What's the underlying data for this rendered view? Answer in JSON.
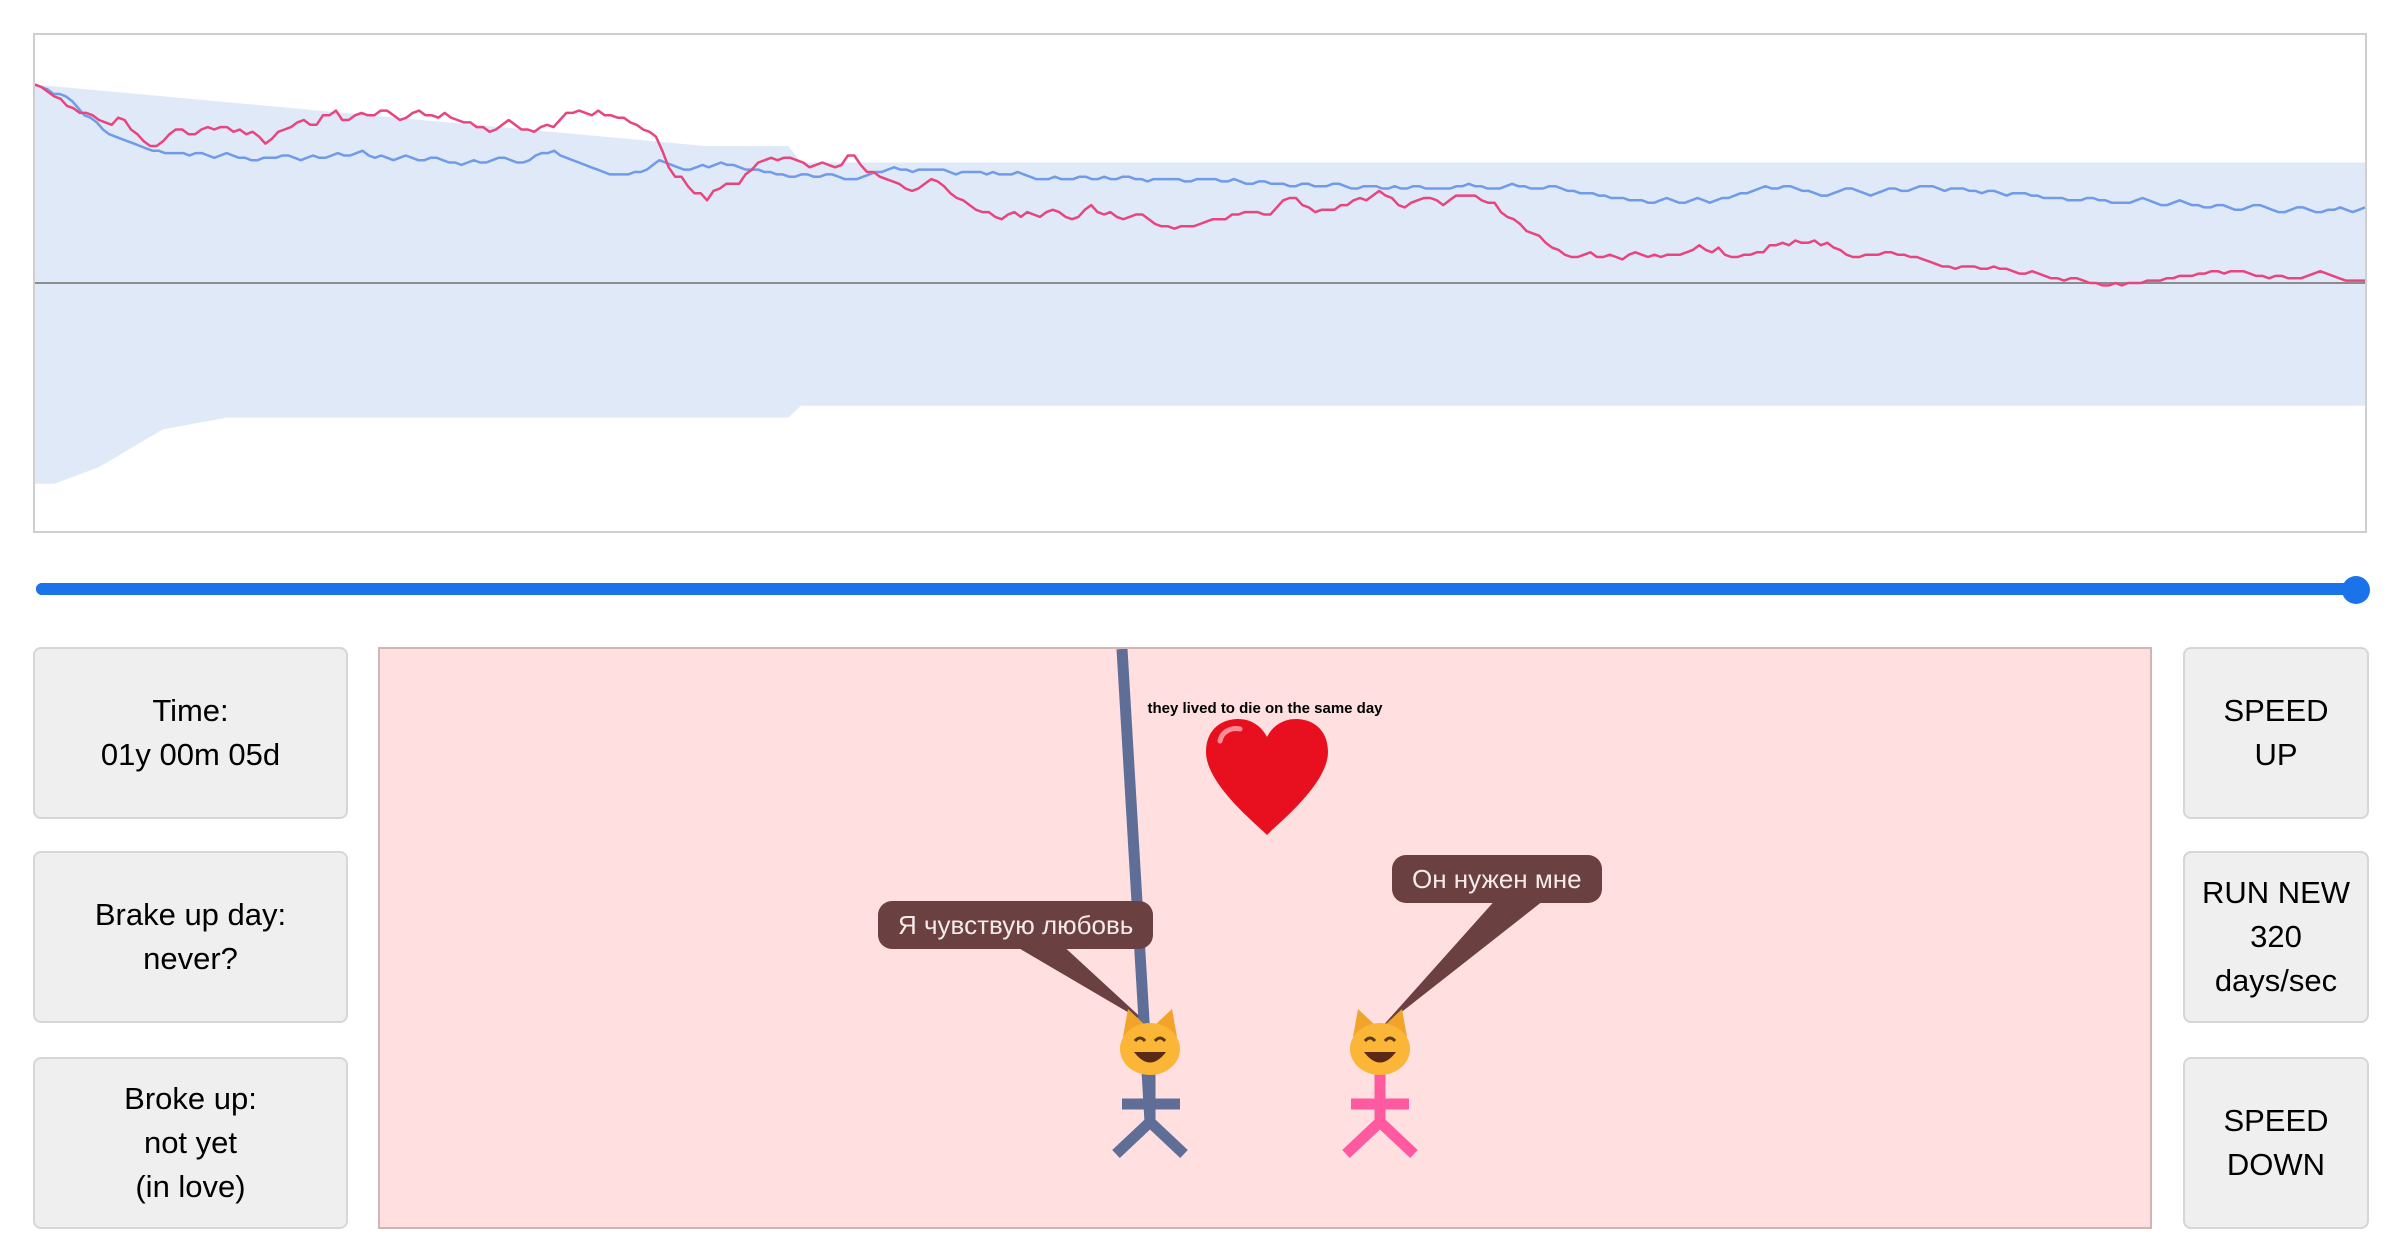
{
  "chart_data": {
    "type": "line",
    "title": "",
    "xlabel": "",
    "ylabel": "",
    "baseline_y": 0,
    "ylim": [
      -1.05,
      1.05
    ],
    "x": [
      0,
      365
    ],
    "series": [
      {
        "color": "#6f9be8",
        "values": [
          0.84,
          0.83,
          0.82,
          0.8,
          0.8,
          0.79,
          0.77,
          0.74,
          0.71,
          0.7,
          0.68,
          0.65,
          0.63,
          0.62,
          0.61,
          0.6,
          0.59,
          0.58,
          0.57,
          0.56,
          0.56,
          0.55,
          0.55,
          0.55,
          0.55,
          0.54,
          0.55,
          0.55,
          0.54,
          0.53,
          0.54,
          0.55,
          0.54,
          0.53,
          0.53,
          0.52,
          0.52,
          0.53,
          0.53,
          0.53,
          0.54,
          0.54,
          0.53,
          0.52,
          0.53,
          0.54,
          0.53,
          0.53,
          0.54,
          0.55,
          0.54,
          0.54,
          0.55,
          0.56,
          0.54,
          0.53,
          0.54,
          0.53,
          0.52,
          0.53,
          0.54,
          0.53,
          0.52,
          0.52,
          0.53,
          0.53,
          0.52,
          0.51,
          0.51,
          0.5,
          0.51,
          0.52,
          0.51,
          0.51,
          0.52,
          0.53,
          0.53,
          0.52,
          0.51,
          0.51,
          0.52,
          0.54,
          0.55,
          0.55,
          0.56,
          0.54,
          0.53,
          0.52,
          0.51,
          0.5,
          0.49,
          0.48,
          0.47,
          0.46,
          0.46,
          0.46,
          0.46,
          0.47,
          0.47,
          0.48,
          0.5,
          0.52,
          0.51,
          0.5,
          0.49,
          0.48,
          0.48,
          0.49,
          0.5,
          0.49,
          0.5,
          0.51,
          0.5,
          0.5,
          0.49,
          0.48,
          0.48,
          0.48,
          0.47,
          0.47,
          0.46,
          0.46,
          0.45,
          0.45,
          0.46,
          0.46,
          0.45,
          0.45,
          0.46,
          0.46,
          0.45,
          0.44,
          0.44,
          0.44,
          0.45,
          0.46,
          0.47,
          0.47,
          0.48,
          0.49,
          0.48,
          0.48,
          0.47,
          0.48,
          0.48,
          0.48,
          0.48,
          0.48,
          0.47,
          0.46,
          0.47,
          0.47,
          0.47,
          0.47,
          0.46,
          0.47,
          0.46,
          0.46,
          0.46,
          0.47,
          0.46,
          0.45,
          0.44,
          0.44,
          0.44,
          0.45,
          0.44,
          0.44,
          0.44,
          0.45,
          0.45,
          0.44,
          0.44,
          0.45,
          0.44,
          0.44,
          0.45,
          0.45,
          0.44,
          0.44,
          0.43,
          0.44,
          0.44,
          0.44,
          0.44,
          0.44,
          0.43,
          0.43,
          0.44,
          0.44,
          0.44,
          0.44,
          0.43,
          0.43,
          0.44,
          0.43,
          0.42,
          0.42,
          0.43,
          0.43,
          0.42,
          0.42,
          0.42,
          0.41,
          0.41,
          0.42,
          0.42,
          0.41,
          0.41,
          0.41,
          0.42,
          0.42,
          0.41,
          0.4,
          0.4,
          0.41,
          0.41,
          0.41,
          0.4,
          0.4,
          0.41,
          0.4,
          0.4,
          0.41,
          0.41,
          0.4,
          0.4,
          0.4,
          0.4,
          0.4,
          0.41,
          0.41,
          0.42,
          0.41,
          0.41,
          0.4,
          0.4,
          0.4,
          0.41,
          0.42,
          0.41,
          0.41,
          0.4,
          0.4,
          0.4,
          0.41,
          0.41,
          0.4,
          0.39,
          0.39,
          0.38,
          0.38,
          0.38,
          0.37,
          0.37,
          0.36,
          0.36,
          0.36,
          0.35,
          0.35,
          0.35,
          0.34,
          0.34,
          0.35,
          0.36,
          0.35,
          0.34,
          0.34,
          0.35,
          0.36,
          0.35,
          0.34,
          0.35,
          0.36,
          0.36,
          0.37,
          0.38,
          0.38,
          0.39,
          0.4,
          0.41,
          0.4,
          0.4,
          0.41,
          0.41,
          0.4,
          0.39,
          0.39,
          0.38,
          0.37,
          0.37,
          0.38,
          0.39,
          0.4,
          0.4,
          0.39,
          0.38,
          0.37,
          0.38,
          0.39,
          0.4,
          0.4,
          0.39,
          0.39,
          0.4,
          0.41,
          0.41,
          0.41,
          0.4,
          0.39,
          0.4,
          0.4,
          0.4,
          0.39,
          0.39,
          0.38,
          0.39,
          0.39,
          0.38,
          0.37,
          0.38,
          0.38,
          0.38,
          0.37,
          0.37,
          0.36,
          0.36,
          0.36,
          0.36,
          0.35,
          0.35,
          0.35,
          0.36,
          0.36,
          0.35,
          0.35,
          0.34,
          0.34,
          0.34,
          0.34,
          0.35,
          0.36,
          0.35,
          0.34,
          0.33,
          0.33,
          0.34,
          0.35,
          0.34,
          0.33,
          0.33,
          0.32,
          0.32,
          0.33,
          0.33,
          0.32,
          0.31,
          0.31,
          0.32,
          0.33,
          0.33,
          0.32,
          0.31,
          0.3,
          0.3,
          0.31,
          0.32,
          0.32,
          0.31,
          0.3,
          0.3,
          0.31,
          0.31,
          0.32,
          0.31,
          0.3,
          0.31,
          0.32
        ]
      },
      {
        "color": "#e8457f",
        "values": [
          0.84,
          0.83,
          0.81,
          0.79,
          0.78,
          0.75,
          0.74,
          0.72,
          0.72,
          0.71,
          0.69,
          0.68,
          0.67,
          0.7,
          0.69,
          0.65,
          0.63,
          0.6,
          0.58,
          0.58,
          0.6,
          0.63,
          0.65,
          0.65,
          0.63,
          0.63,
          0.65,
          0.66,
          0.65,
          0.66,
          0.66,
          0.64,
          0.65,
          0.63,
          0.64,
          0.62,
          0.59,
          0.61,
          0.64,
          0.65,
          0.66,
          0.68,
          0.69,
          0.67,
          0.67,
          0.71,
          0.71,
          0.73,
          0.69,
          0.69,
          0.71,
          0.72,
          0.71,
          0.71,
          0.73,
          0.73,
          0.71,
          0.69,
          0.7,
          0.72,
          0.73,
          0.71,
          0.71,
          0.7,
          0.72,
          0.7,
          0.69,
          0.68,
          0.68,
          0.66,
          0.66,
          0.64,
          0.65,
          0.67,
          0.69,
          0.67,
          0.65,
          0.65,
          0.64,
          0.66,
          0.67,
          0.66,
          0.69,
          0.72,
          0.72,
          0.73,
          0.72,
          0.71,
          0.73,
          0.71,
          0.71,
          0.7,
          0.7,
          0.68,
          0.67,
          0.65,
          0.64,
          0.62,
          0.56,
          0.49,
          0.45,
          0.45,
          0.41,
          0.38,
          0.38,
          0.35,
          0.39,
          0.4,
          0.42,
          0.42,
          0.42,
          0.46,
          0.48,
          0.51,
          0.52,
          0.53,
          0.52,
          0.53,
          0.53,
          0.52,
          0.51,
          0.49,
          0.5,
          0.51,
          0.5,
          0.49,
          0.5,
          0.54,
          0.54,
          0.5,
          0.47,
          0.47,
          0.45,
          0.44,
          0.43,
          0.42,
          0.4,
          0.39,
          0.4,
          0.42,
          0.44,
          0.43,
          0.41,
          0.38,
          0.36,
          0.35,
          0.33,
          0.31,
          0.3,
          0.3,
          0.28,
          0.27,
          0.29,
          0.3,
          0.28,
          0.3,
          0.29,
          0.28,
          0.3,
          0.31,
          0.3,
          0.28,
          0.27,
          0.28,
          0.31,
          0.33,
          0.3,
          0.29,
          0.3,
          0.28,
          0.27,
          0.28,
          0.29,
          0.29,
          0.27,
          0.25,
          0.24,
          0.24,
          0.23,
          0.24,
          0.24,
          0.24,
          0.25,
          0.26,
          0.27,
          0.27,
          0.27,
          0.29,
          0.29,
          0.3,
          0.3,
          0.3,
          0.29,
          0.29,
          0.32,
          0.35,
          0.36,
          0.36,
          0.33,
          0.32,
          0.3,
          0.31,
          0.31,
          0.31,
          0.33,
          0.33,
          0.35,
          0.36,
          0.35,
          0.37,
          0.39,
          0.37,
          0.36,
          0.33,
          0.32,
          0.34,
          0.35,
          0.36,
          0.36,
          0.35,
          0.33,
          0.35,
          0.37,
          0.37,
          0.37,
          0.37,
          0.35,
          0.34,
          0.34,
          0.3,
          0.28,
          0.27,
          0.25,
          0.22,
          0.21,
          0.2,
          0.17,
          0.15,
          0.14,
          0.12,
          0.11,
          0.11,
          0.12,
          0.13,
          0.11,
          0.11,
          0.12,
          0.11,
          0.1,
          0.12,
          0.13,
          0.12,
          0.11,
          0.12,
          0.11,
          0.12,
          0.12,
          0.12,
          0.13,
          0.14,
          0.16,
          0.14,
          0.13,
          0.15,
          0.12,
          0.11,
          0.11,
          0.12,
          0.12,
          0.13,
          0.13,
          0.16,
          0.16,
          0.17,
          0.16,
          0.18,
          0.17,
          0.17,
          0.18,
          0.16,
          0.17,
          0.15,
          0.14,
          0.12,
          0.11,
          0.11,
          0.12,
          0.12,
          0.12,
          0.13,
          0.13,
          0.12,
          0.12,
          0.11,
          0.11,
          0.1,
          0.09,
          0.08,
          0.07,
          0.07,
          0.06,
          0.07,
          0.07,
          0.07,
          0.06,
          0.06,
          0.07,
          0.06,
          0.06,
          0.05,
          0.04,
          0.04,
          0.05,
          0.04,
          0.03,
          0.02,
          0.02,
          0.01,
          0.02,
          0.02,
          0.01,
          0.0,
          0.0,
          -0.01,
          -0.01,
          0.0,
          -0.01,
          0.0,
          0.0,
          0.0,
          0.01,
          0.01,
          0.01,
          0.02,
          0.02,
          0.03,
          0.03,
          0.03,
          0.04,
          0.04,
          0.05,
          0.05,
          0.04,
          0.05,
          0.05,
          0.05,
          0.04,
          0.03,
          0.03,
          0.02,
          0.03,
          0.03,
          0.02,
          0.02,
          0.02,
          0.03,
          0.04,
          0.05,
          0.04,
          0.03,
          0.02,
          0.01,
          0.01,
          0.01,
          0.01
        ]
      }
    ],
    "band": {
      "color": "#e0e9f8",
      "upper": [
        [
          0,
          0.84
        ],
        [
          105,
          0.58
        ],
        [
          118,
          0.58
        ],
        [
          120,
          0.51
        ],
        [
          365,
          0.51
        ]
      ],
      "lower": [
        [
          0,
          -0.85
        ],
        [
          3,
          -0.85
        ],
        [
          10,
          -0.78
        ],
        [
          20,
          -0.62
        ],
        [
          30,
          -0.57
        ],
        [
          118,
          -0.57
        ],
        [
          120,
          -0.52
        ],
        [
          365,
          -0.52
        ]
      ]
    },
    "baseline_color": "#8c8c8c"
  },
  "slider": {
    "value_fraction": 1.0,
    "fill_color": "#1a73e8",
    "track_color": "#1a73e8",
    "thumb_color": "#1a73e8"
  },
  "left_panel": {
    "time": "Time:\n01y 00m 05d",
    "brake_up_day": "Brake up day:\nnever?",
    "broke_up": "Broke up:\nnot yet\n(in love)"
  },
  "right_panel": {
    "speed_up": "SPEED\nUP",
    "run_new": "RUN NEW\n320\ndays/sec",
    "speed_down": "SPEED\nDOWN"
  },
  "scene": {
    "background": "#ffdfdf",
    "caption": "they lived to die on the same day",
    "heart_icon": "red-heart-icon",
    "heart_color": "#e8101e",
    "left_character": {
      "speech": "Я чувствую любовь",
      "color": "#5f6e96",
      "face_icon": "smiling-cat-icon"
    },
    "right_character": {
      "speech": "Он нужен мне",
      "color": "#ff5aa0",
      "face_icon": "smiling-cat-icon"
    },
    "bubble_color": "#6b4040"
  }
}
